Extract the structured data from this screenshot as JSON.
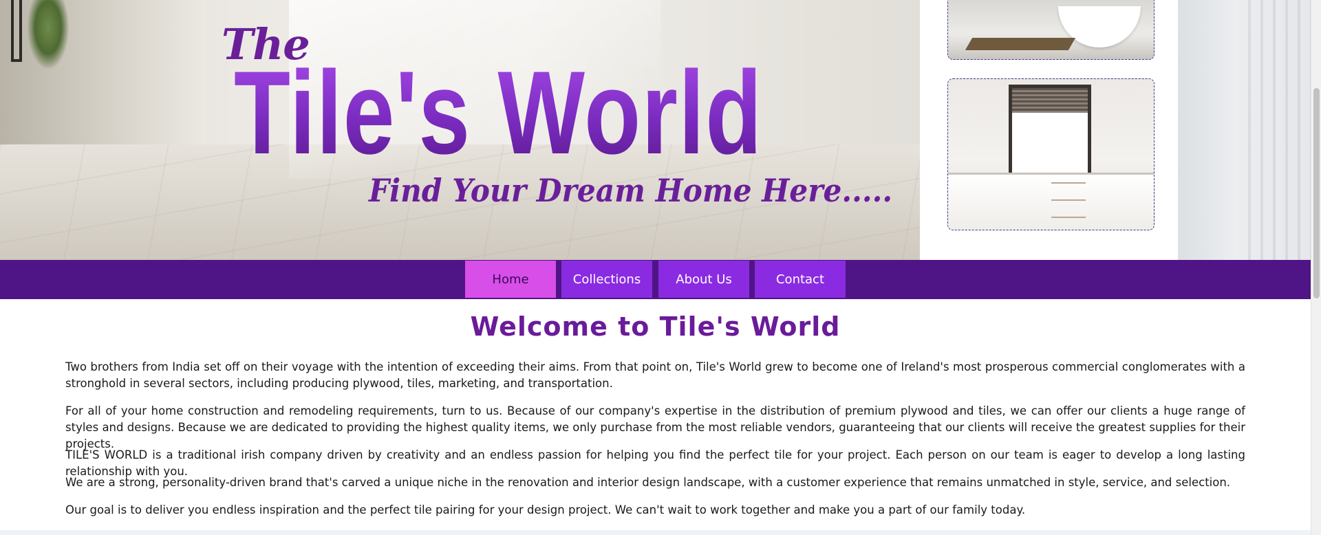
{
  "hero": {
    "logo_the": "The",
    "logo_main": "Tile's World",
    "tagline": "Find Your Dream Home Here....."
  },
  "nav": {
    "items": [
      {
        "label": "Home",
        "active": true
      },
      {
        "label": "Collections",
        "active": false
      },
      {
        "label": "About Us",
        "active": false
      },
      {
        "label": "Contact",
        "active": false
      }
    ]
  },
  "main": {
    "heading": "Welcome to Tile's World",
    "paragraphs": [
      "Two brothers from India set off on their voyage with the intention of exceeding their aims. From that point on, Tile's World grew to become one of Ireland's most prosperous commercial conglomerates with a stronghold in several sectors, including producing plywood, tiles, marketing, and transportation.",
      "For all of your home construction and remodeling requirements, turn to us. Because of our company's expertise in the distribution of premium plywood and tiles, we can offer our clients a huge range of styles and designs. Because we are dedicated to providing the highest quality items, we only purchase from the most reliable vendors, guaranteeing that our clients will receive the greatest supplies for their projects.",
      "TILE'S WORLD is a traditional irish company driven by creativity and an endless passion for helping you find the perfect tile for your project. Each person on our team is eager to develop a long lasting relationship with you.",
      "We are a strong, personality-driven brand that's carved a unique niche in the renovation and interior design landscape, with a customer experience that remains unmatched in style, service, and selection.",
      "Our goal is to deliver you endless inspiration and the perfect tile pairing for your design project. We can't wait to work together and make you a part of our family today."
    ]
  },
  "colors": {
    "nav_background": "#4f1485",
    "nav_item": "#8a2be2",
    "nav_item_active": "#d84ee8",
    "heading": "#6a1b9a",
    "logo": "#7d2bbd"
  }
}
